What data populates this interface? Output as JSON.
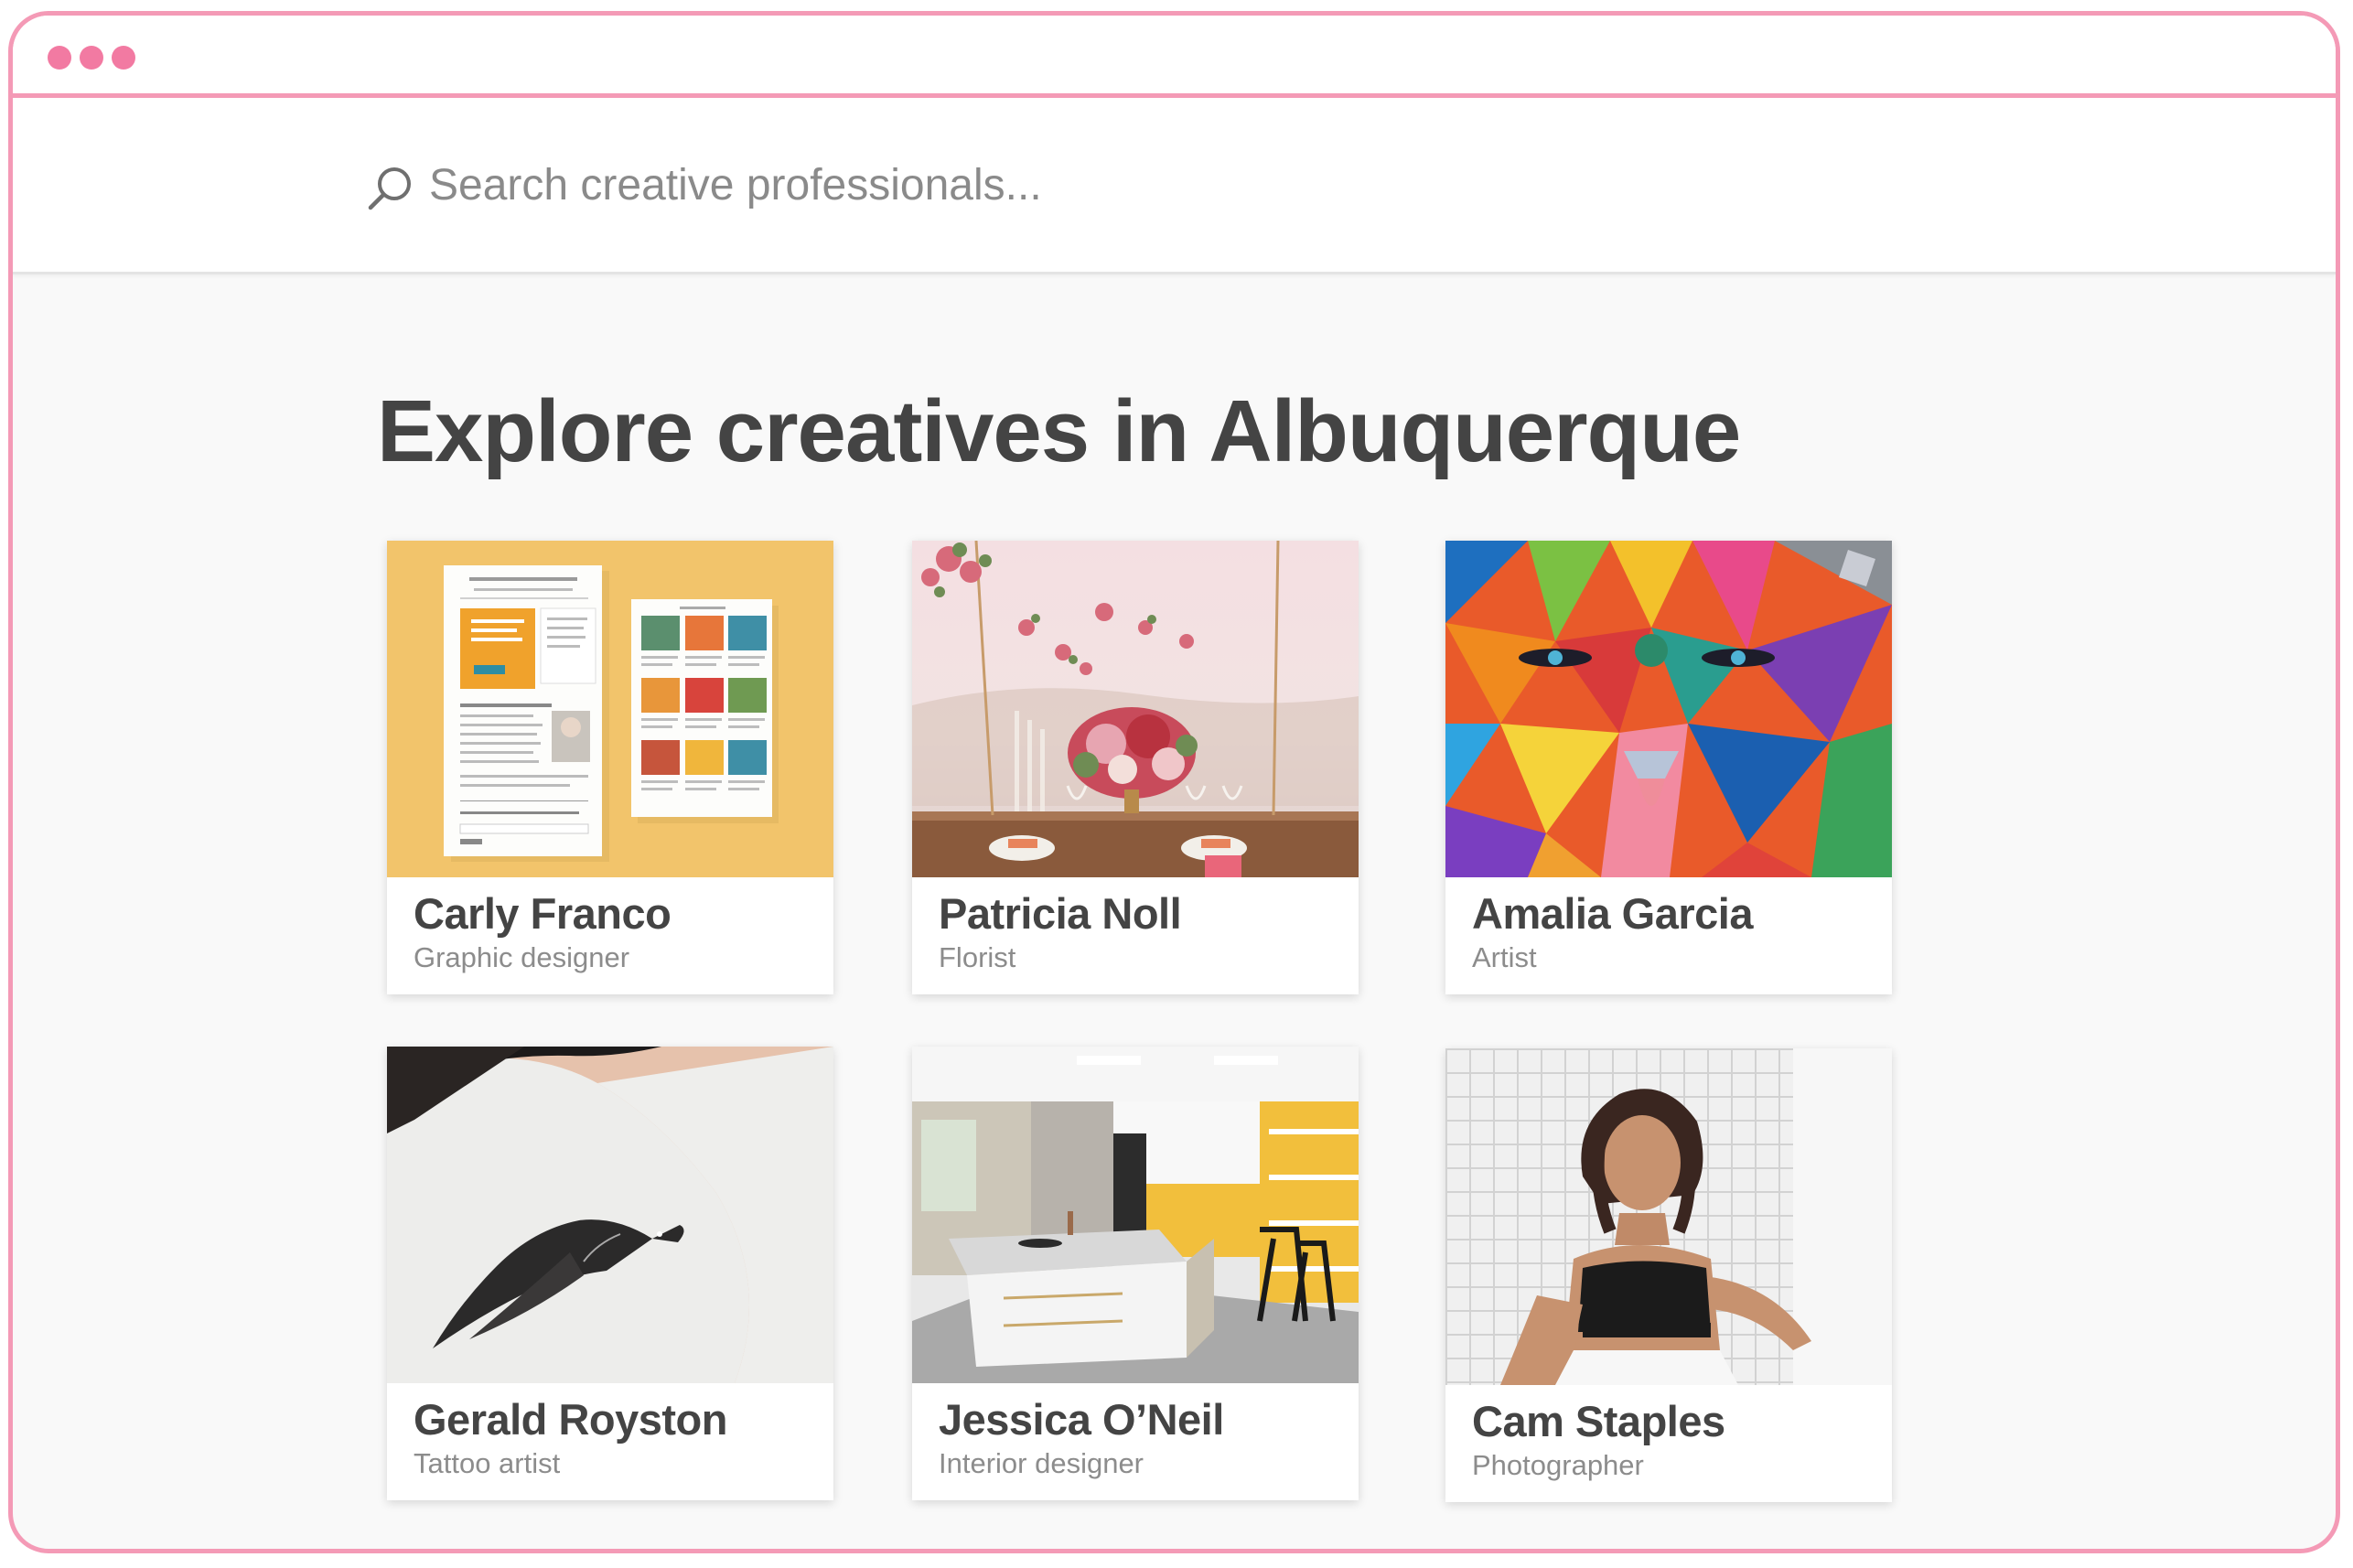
{
  "search": {
    "placeholder": "Search creative professionals..."
  },
  "page": {
    "heading": "Explore creatives in Albuquerque"
  },
  "creatives": [
    {
      "name": "Carly Franco",
      "role": "Graphic designer"
    },
    {
      "name": "Patricia Noll",
      "role": "Florist"
    },
    {
      "name": "Amalia Garcia",
      "role": "Artist"
    },
    {
      "name": "Gerald Royston",
      "role": "Tattoo artist"
    },
    {
      "name": "Jessica O’Neil",
      "role": "Interior designer"
    },
    {
      "name": "Cam Staples",
      "role": "Photographer"
    }
  ],
  "colors": {
    "accent": "#f49ab6",
    "dots": "#f27aa2",
    "heading": "#444444",
    "subtext": "#8c8c8c"
  }
}
